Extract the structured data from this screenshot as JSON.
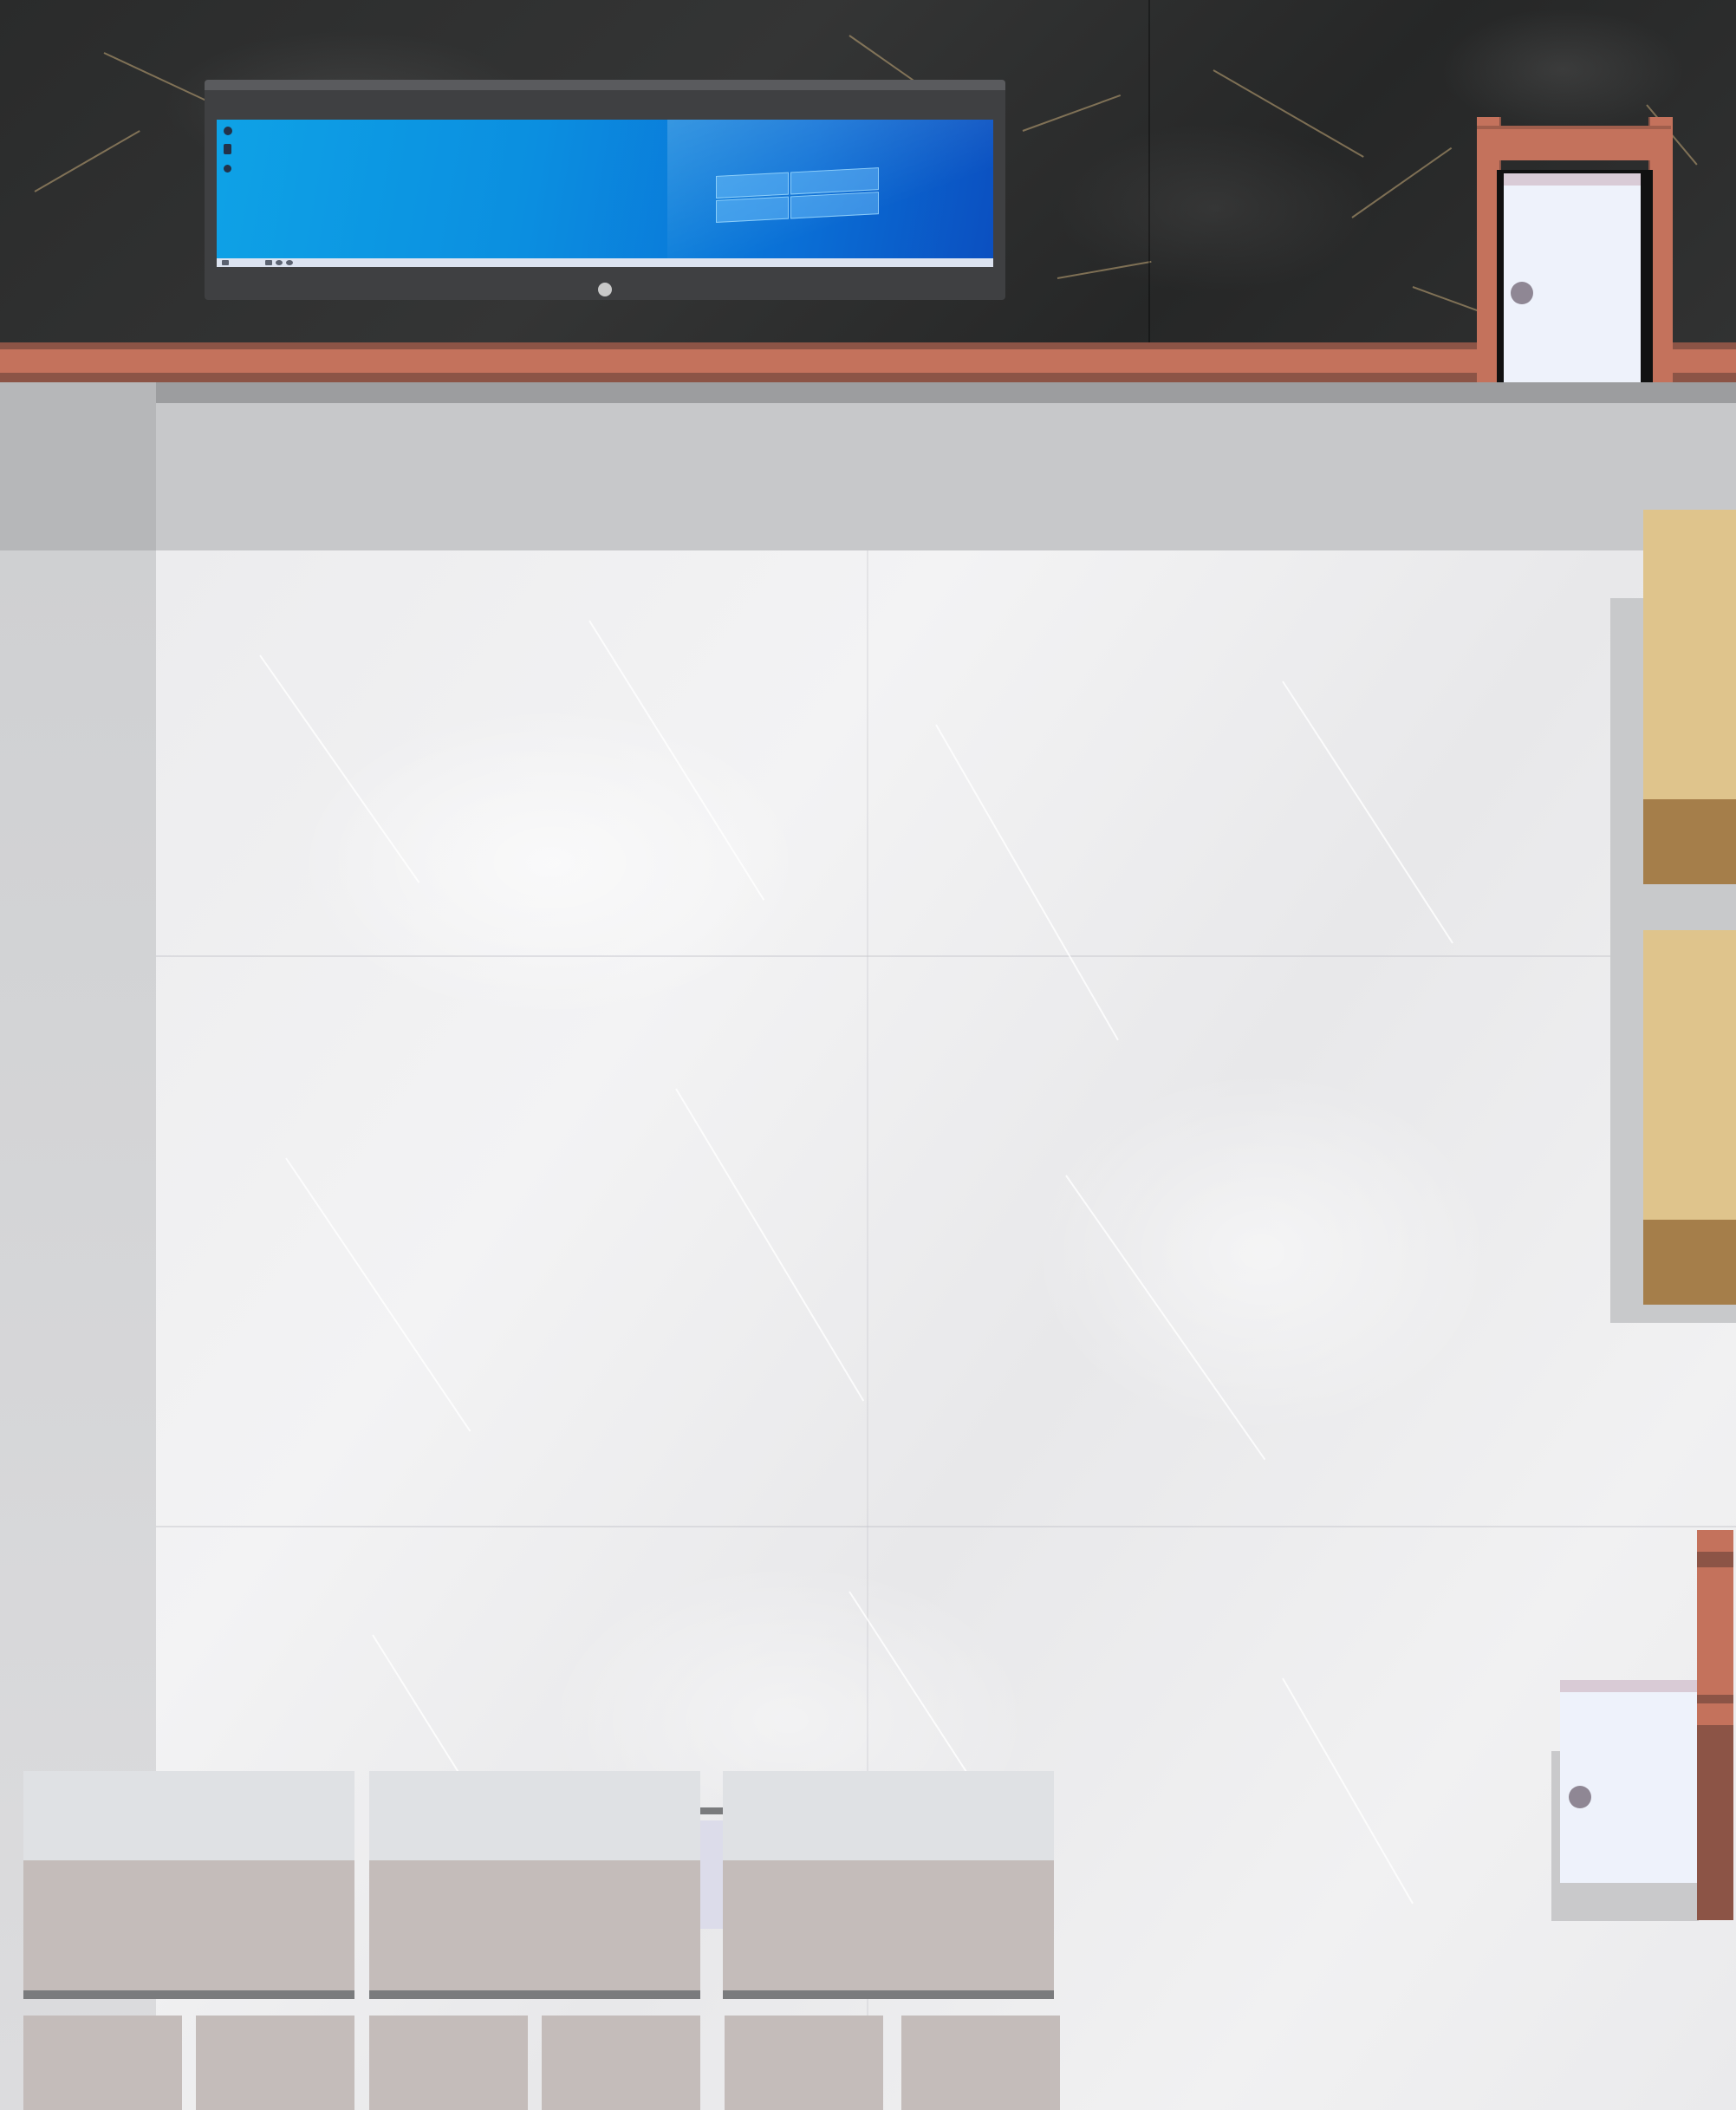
{
  "scene": {
    "description_free": true,
    "colors": {
      "wall_marble": "#2e2f2f",
      "trim": "#c4725c",
      "trim_dark": "#8c5446",
      "floor": "#ececee",
      "door": "#eef2fb",
      "door_knob": "#8f8794",
      "bench_top": "#dfc48c",
      "bench_foot": "#a57e4a",
      "counter_top": "#dfe1e4",
      "counter_body": "#c4bcba",
      "screen_blue": "#0b8fe0"
    }
  },
  "monitor": {
    "os_logo_icon": "windows-logo-icon",
    "desktop_icons": [
      "desktop-icon",
      "desktop-icon",
      "desktop-icon"
    ],
    "taskbar_icons": [
      "start-icon",
      "app-icon",
      "app-icon",
      "app-icon"
    ]
  },
  "doors": [
    {
      "name": "door-back-wall",
      "icon": "door-icon"
    },
    {
      "name": "door-right-wall",
      "icon": "door-icon"
    }
  ],
  "benches": [
    {
      "name": "bench-1"
    },
    {
      "name": "bench-2"
    }
  ],
  "counters": [
    {
      "name": "counter-1"
    },
    {
      "name": "counter-2"
    },
    {
      "name": "counter-3"
    }
  ]
}
